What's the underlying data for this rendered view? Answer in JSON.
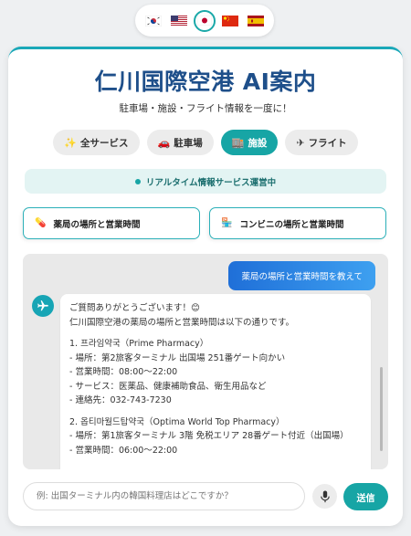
{
  "languages": [
    {
      "code": "ko",
      "icon": "korea-flag-icon",
      "active": false
    },
    {
      "code": "en",
      "icon": "us-flag-icon",
      "active": false
    },
    {
      "code": "ja",
      "icon": "japan-flag-icon",
      "active": true
    },
    {
      "code": "zh",
      "icon": "china-flag-icon",
      "active": false
    },
    {
      "code": "es",
      "icon": "spain-flag-icon",
      "active": false
    }
  ],
  "header": {
    "title": "仁川国際空港 AI案内",
    "subtitle": "駐車場・施設・フライト情報を一度に！"
  },
  "tabs": [
    {
      "label": "全サービス",
      "icon": "sparkle-icon"
    },
    {
      "label": "駐車場",
      "icon": "car-icon"
    },
    {
      "label": "施設",
      "icon": "facility-icon",
      "active": true
    },
    {
      "label": "フライト",
      "icon": "airplane-icon"
    }
  ],
  "status": {
    "text": "リアルタイム情報サービス運営中"
  },
  "quick_actions": [
    {
      "label": "薬局の場所と営業時間",
      "icon": "pill-icon"
    },
    {
      "label": "コンビニの場所と営業時間",
      "icon": "store-icon"
    }
  ],
  "chat": {
    "user_message": "薬局の場所と営業時間を教えて",
    "bot_lines": [
      "ご質問ありがとうございます！😊",
      "仁川国際空港の薬局の場所と営業時間は以下の通りです。",
      "",
      "1. 프라임약국（Prime Pharmacy）",
      "- 場所：第2旅客ターミナル 出国場 251番ゲート向かい",
      "- 営業時間：08:00～22:00",
      "- サービス：医薬品、健康補助食品、衛生用品など",
      "- 連絡先：032-743-7230",
      "",
      "2. 옵티마월드탑약국（Optima World Top Pharmacy）",
      "- 場所：第1旅客ターミナル 3階 免税エリア 28番ゲート付近（出国場）",
      "- 営業時間：06:00～22:00"
    ]
  },
  "input": {
    "placeholder": "例: 出国ターミナル内の韓国料理店はどこですか？",
    "send_label": "送信"
  },
  "colors": {
    "accent": "#17a5a5",
    "title": "#1e4f8a"
  }
}
